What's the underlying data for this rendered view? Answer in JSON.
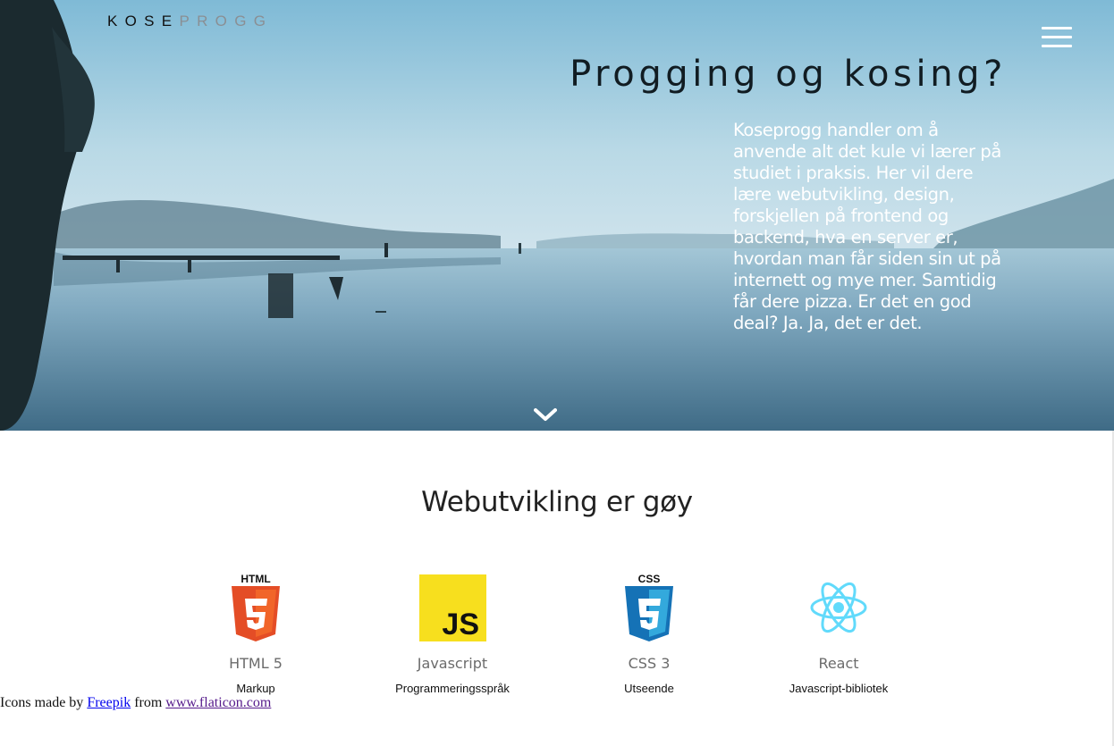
{
  "logo": {
    "part1": "KOSE",
    "part2": "PROGG"
  },
  "hero": {
    "title": "Progging og kosing?",
    "text": "Koseprogg handler om å anvende alt det kule vi lærer på studiet i praksis. Her vil dere lære webutvikling, design, forskjellen på frontend og backend, hva en server er, hvordan man får siden sin ut på internett og mye mer. Samtidig får dere pizza. Er det en god deal? Ja. Ja, det er det."
  },
  "section": {
    "title": "Webutvikling er gøy",
    "technologies": [
      {
        "name": "HTML 5",
        "description": "Markup",
        "icon": "html5-icon"
      },
      {
        "name": "Javascript",
        "description": "Programmeringsspråk",
        "icon": "javascript-icon"
      },
      {
        "name": "CSS 3",
        "description": "Utseende",
        "icon": "css3-icon"
      },
      {
        "name": "React",
        "description": "Javascript-bibliotek",
        "icon": "react-icon"
      }
    ]
  },
  "credit": {
    "prefix": "Icons made by",
    "author": "Freepik",
    "middle": "from",
    "site": "www.flaticon.com"
  },
  "colors": {
    "html5": "#e44d26",
    "javascript": "#f7df1e",
    "css3": "#1572b6",
    "react": "#61dafb"
  }
}
